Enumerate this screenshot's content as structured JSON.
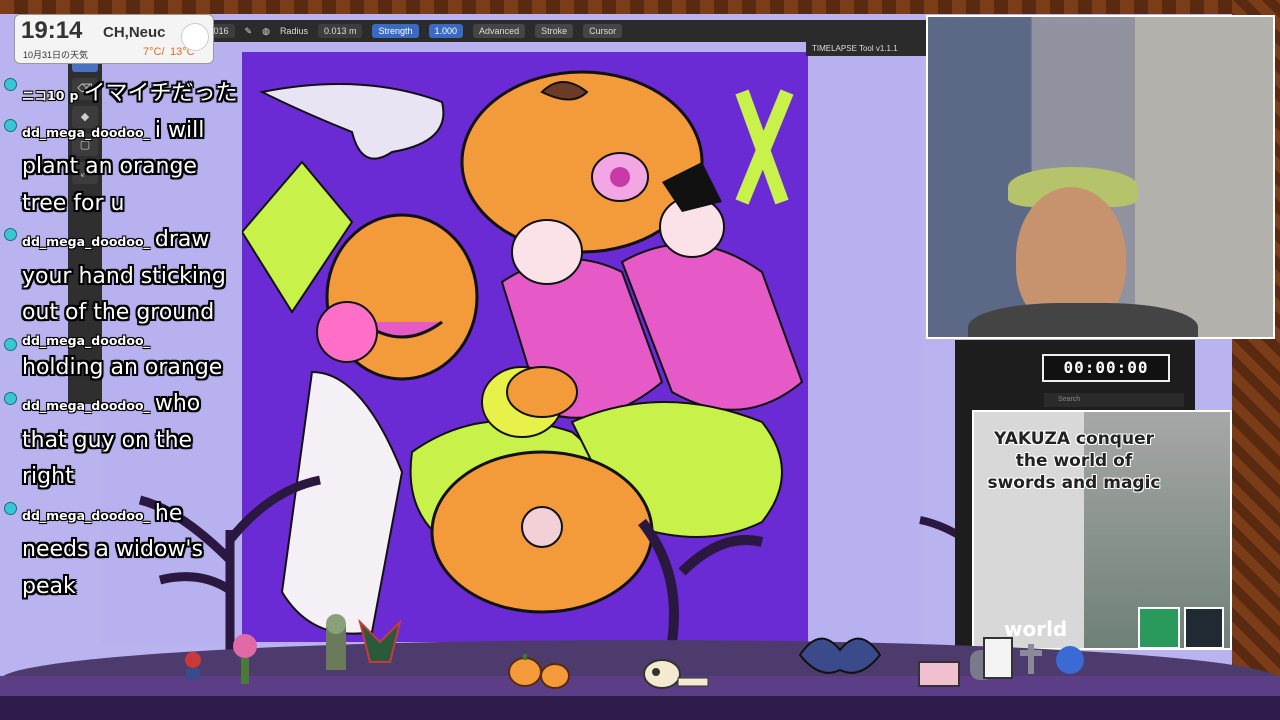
{
  "clock": {
    "time": "19:14",
    "city": "CH,Neuc",
    "date": "10月31日の天気",
    "temp_low": "7°C/",
    "temp_high": "13°C"
  },
  "toolbar": {
    "layer": "al.016",
    "radius_label": "Radius",
    "radius_value": "0.013 m",
    "strength_label": "Strength",
    "strength_value": "1.000",
    "advanced": "Advanced",
    "stroke": "Stroke",
    "cursor": "Cursor"
  },
  "timelapse": {
    "label": "TIMELAPSE Tool v1.1.1"
  },
  "search": {
    "placeholder": "Search"
  },
  "timer": {
    "value": "00:00:00"
  },
  "chat": [
    {
      "user": "ニコ10",
      "badge": "p",
      "text": "イマイチだった"
    },
    {
      "user": "dd_mega_doodoo_",
      "text": "i will plant an orange tree for u"
    },
    {
      "user": "dd_mega_doodoo_",
      "text": "draw your hand sticking out of the ground"
    },
    {
      "user": "dd_mega_doodoo_",
      "text": "holding an orange"
    },
    {
      "user": "dd_mega_doodoo_",
      "text": "who that guy on the right"
    },
    {
      "user": "dd_mega_doodoo_",
      "text": "he needs a widow's peak"
    }
  ],
  "book": {
    "title": "YAKUZA conquer the world of swords and magic",
    "world_text": "world"
  },
  "colors": {
    "artwork_bg": "#6a2bd4",
    "canvas_bg": "#b7b1ef",
    "pumpkin": "#f39a3a",
    "lime": "#c8f24a",
    "pink": "#e65ac8"
  }
}
